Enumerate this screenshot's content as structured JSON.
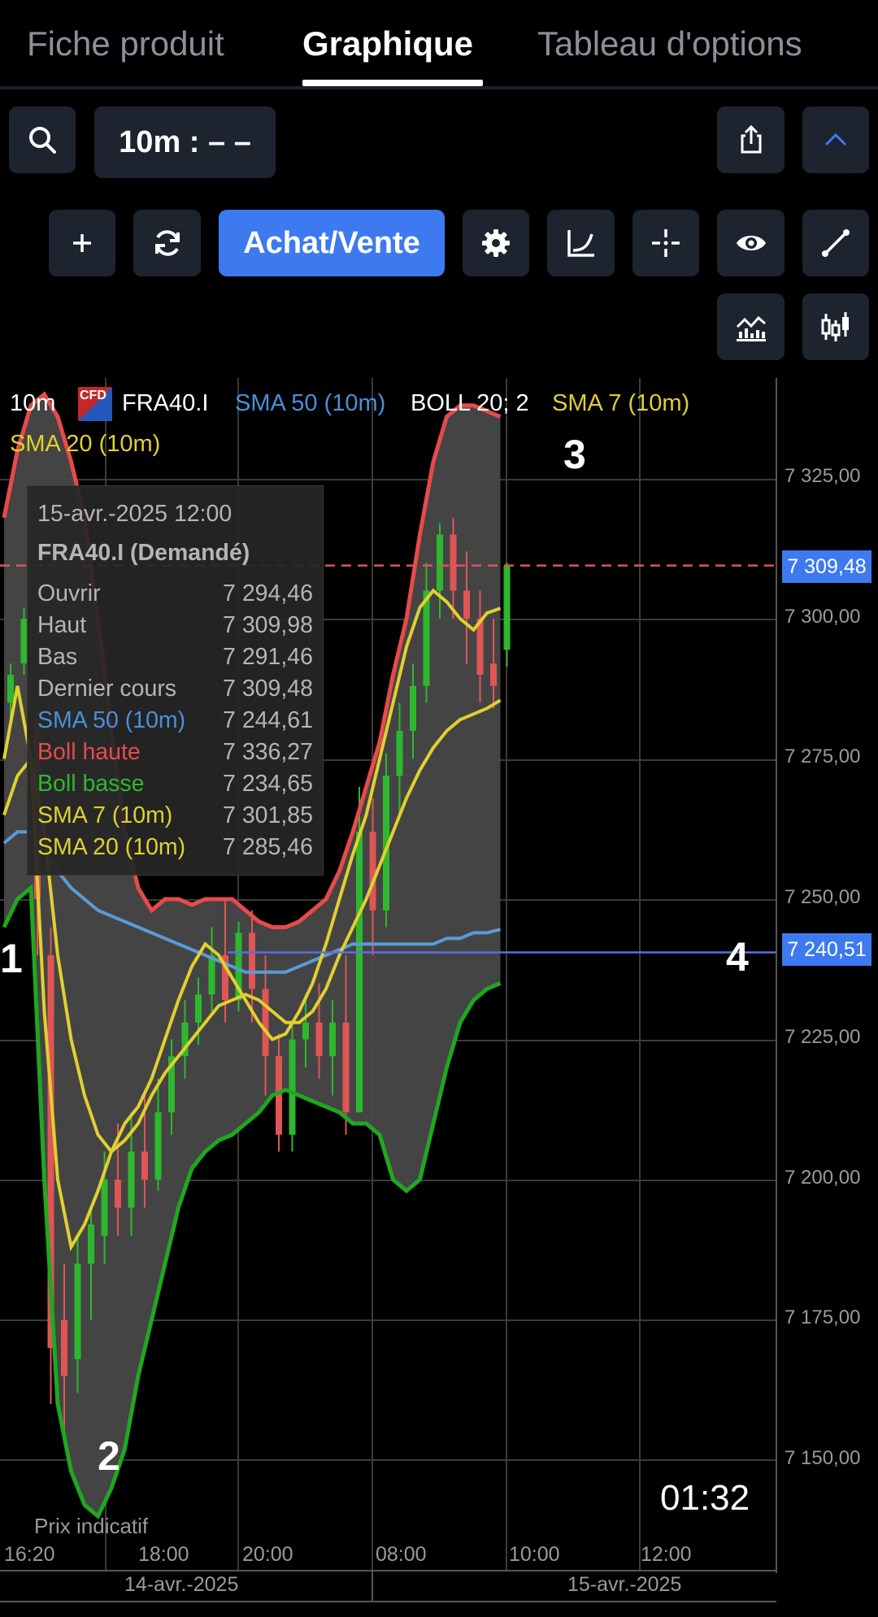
{
  "tabs": [
    {
      "label": "Fiche produit",
      "active": false
    },
    {
      "label": "Graphique",
      "active": true
    },
    {
      "label": "Tableau d'options",
      "active": false
    }
  ],
  "toolbar": {
    "interval_label": "10m : – –",
    "trade_button_label": "Achat/Vente",
    "icons": [
      "search-icon",
      "share-icon",
      "chevron-up-icon",
      "plus-icon",
      "refresh-icon",
      "gear-icon",
      "curve-icon",
      "crosshair-icon",
      "eye-icon",
      "draw-line-icon",
      "indicators-icon",
      "candlestick-icon"
    ]
  },
  "chart_header": {
    "interval": "10m",
    "cfd_badge": "CFD",
    "symbol": "FRA40.I",
    "sma50_label": "SMA 50 (10m)",
    "boll_label": "BOLL 20; 2",
    "sma7_label": "SMA 7 (10m)",
    "sma20_label": "SMA 20 (10m)"
  },
  "tooltip": {
    "datetime": "15-avr.-2025 12:00",
    "instrument": "FRA40.I (Demandé)",
    "rows": [
      {
        "label": "Ouvrir",
        "value": "7 294,46",
        "color": "#b5b5b5"
      },
      {
        "label": "Haut",
        "value": "7 309,98",
        "color": "#b5b5b5"
      },
      {
        "label": "Bas",
        "value": "7 291,46",
        "color": "#b5b5b5"
      },
      {
        "label": "Dernier cours",
        "value": "7 309,48",
        "color": "#b5b5b5"
      },
      {
        "label": "SMA 50 (10m)",
        "value": "7 244,61",
        "color": "#4a90d9"
      },
      {
        "label": "Boll haute",
        "value": "7 336,27",
        "color": "#e84a4a"
      },
      {
        "label": "Boll basse",
        "value": "7 234,65",
        "color": "#2eb82e"
      },
      {
        "label": "SMA 7 (10m)",
        "value": "7 301,85",
        "color": "#e0d030"
      },
      {
        "label": "SMA 20 (10m)",
        "value": "7 285,46",
        "color": "#e0d030"
      }
    ]
  },
  "price_axis": [
    "7 325,00",
    "7 300,00",
    "7 275,00",
    "7 250,00",
    "7 225,00",
    "7 200,00",
    "7 175,00",
    "7 150,00"
  ],
  "last_price_flag": "7 309,48",
  "hline_flag": "7 240,51",
  "time_axis": [
    "16:20",
    "18:00",
    "20:00",
    "08:00",
    "10:00",
    "12:00"
  ],
  "date_axis": [
    "14-avr.-2025",
    "15-avr.-2025"
  ],
  "markers": [
    "1",
    "2",
    "3",
    "4"
  ],
  "indicative_price_label": "Prix indicatif",
  "countdown": "01:32",
  "colors": {
    "bull": "#2eb82e",
    "bear": "#e05555",
    "boll_upper": "#e84a4a",
    "boll_lower": "#1fa81f",
    "sma": "#e0d030",
    "sma50": "#5a9bd8",
    "accent": "#3d7af0"
  },
  "chart_data": {
    "type": "candlestick",
    "symbol": "FRA40.I",
    "interval": "10m",
    "y_range": [
      7135,
      7345
    ],
    "last_price": 7309.48,
    "horizontal_line": 7240.51,
    "candles": [
      {
        "o": 7285,
        "h": 7292,
        "c": 7290,
        "l": 7282
      },
      {
        "o": 7292,
        "h": 7302,
        "c": 7300,
        "l": 7290
      },
      {
        "o": 7282,
        "h": 7285,
        "c": 7250,
        "l": 7240
      },
      {
        "o": 7240,
        "h": 7245,
        "c": 7170,
        "l": 7160
      },
      {
        "o": 7175,
        "h": 7185,
        "c": 7165,
        "l": 7155
      },
      {
        "o": 7168,
        "h": 7190,
        "c": 7185,
        "l": 7162
      },
      {
        "o": 7185,
        "h": 7195,
        "c": 7192,
        "l": 7175
      },
      {
        "o": 7190,
        "h": 7205,
        "c": 7200,
        "l": 7185
      },
      {
        "o": 7200,
        "h": 7210,
        "c": 7195,
        "l": 7190
      },
      {
        "o": 7195,
        "h": 7212,
        "c": 7205,
        "l": 7190
      },
      {
        "o": 7205,
        "h": 7215,
        "c": 7200,
        "l": 7195
      },
      {
        "o": 7200,
        "h": 7218,
        "c": 7212,
        "l": 7198
      },
      {
        "o": 7212,
        "h": 7225,
        "c": 7222,
        "l": 7208
      },
      {
        "o": 7222,
        "h": 7232,
        "c": 7228,
        "l": 7218
      },
      {
        "o": 7228,
        "h": 7236,
        "c": 7233,
        "l": 7224
      },
      {
        "o": 7233,
        "h": 7245,
        "c": 7240,
        "l": 7230
      },
      {
        "o": 7240,
        "h": 7250,
        "c": 7232,
        "l": 7228
      },
      {
        "o": 7232,
        "h": 7246,
        "c": 7244,
        "l": 7230
      },
      {
        "o": 7244,
        "h": 7248,
        "c": 7234,
        "l": 7228
      },
      {
        "o": 7234,
        "h": 7240,
        "c": 7222,
        "l": 7215
      },
      {
        "o": 7222,
        "h": 7226,
        "c": 7208,
        "l": 7205
      },
      {
        "o": 7208,
        "h": 7228,
        "c": 7225,
        "l": 7205
      },
      {
        "o": 7225,
        "h": 7233,
        "c": 7228,
        "l": 7220
      },
      {
        "o": 7228,
        "h": 7235,
        "c": 7222,
        "l": 7218
      },
      {
        "o": 7222,
        "h": 7232,
        "c": 7228,
        "l": 7215
      },
      {
        "o": 7228,
        "h": 7240,
        "c": 7212,
        "l": 7208
      },
      {
        "o": 7212,
        "h": 7270,
        "c": 7262,
        "l": 7212
      },
      {
        "o": 7262,
        "h": 7268,
        "c": 7248,
        "l": 7240
      },
      {
        "o": 7248,
        "h": 7276,
        "c": 7272,
        "l": 7245
      },
      {
        "o": 7272,
        "h": 7285,
        "c": 7280,
        "l": 7265
      },
      {
        "o": 7280,
        "h": 7292,
        "c": 7288,
        "l": 7275
      },
      {
        "o": 7288,
        "h": 7310,
        "c": 7305,
        "l": 7285
      },
      {
        "o": 7305,
        "h": 7317,
        "c": 7315,
        "l": 7300
      },
      {
        "o": 7315,
        "h": 7318,
        "c": 7305,
        "l": 7300
      },
      {
        "o": 7305,
        "h": 7312,
        "c": 7300,
        "l": 7292
      },
      {
        "o": 7300,
        "h": 7305,
        "c": 7290,
        "l": 7285
      },
      {
        "o": 7292,
        "h": 7300,
        "c": 7288,
        "l": 7284
      },
      {
        "o": 7294.46,
        "h": 7309.98,
        "c": 7309.48,
        "l": 7291.46
      }
    ],
    "series": [
      {
        "name": "Boll haute",
        "values": [
          7318,
          7330,
          7338,
          7340,
          7336,
          7328,
          7318,
          7300,
          7280,
          7262,
          7252,
          7248,
          7250,
          7250,
          7249,
          7250,
          7250,
          7250,
          7248,
          7246,
          7245,
          7245,
          7246,
          7248,
          7250,
          7255,
          7262,
          7270,
          7278,
          7290,
          7300,
          7315,
          7328,
          7336,
          7338,
          7338,
          7337,
          7336
        ]
      },
      {
        "name": "Boll basse",
        "values": [
          7245,
          7250,
          7252,
          7200,
          7160,
          7148,
          7142,
          7140,
          7145,
          7152,
          7165,
          7175,
          7185,
          7195,
          7202,
          7205,
          7207,
          7208,
          7210,
          7212,
          7215,
          7216,
          7215,
          7214,
          7213,
          7212,
          7210,
          7210,
          7208,
          7200,
          7198,
          7200,
          7210,
          7220,
          7228,
          7232,
          7234,
          7235
        ]
      },
      {
        "name": "SMA 7 (10m)",
        "values": [
          7275,
          7288,
          7275,
          7230,
          7200,
          7188,
          7192,
          7198,
          7205,
          7210,
          7213,
          7218,
          7225,
          7232,
          7238,
          7242,
          7240,
          7236,
          7232,
          7228,
          7225,
          7226,
          7230,
          7235,
          7242,
          7250,
          7258,
          7265,
          7275,
          7285,
          7295,
          7302,
          7305,
          7303,
          7300,
          7298,
          7301,
          7301.85
        ]
      },
      {
        "name": "SMA 20 (10m)",
        "values": [
          7265,
          7272,
          7275,
          7262,
          7240,
          7225,
          7215,
          7208,
          7205,
          7207,
          7210,
          7215,
          7219,
          7222,
          7225,
          7228,
          7231,
          7232,
          7233,
          7232,
          7230,
          7228,
          7228,
          7230,
          7234,
          7240,
          7245,
          7250,
          7256,
          7262,
          7268,
          7273,
          7277,
          7280,
          7282,
          7283,
          7284,
          7285.46
        ]
      },
      {
        "name": "SMA 50 (10m)",
        "values": [
          7260,
          7262,
          7262,
          7258,
          7255,
          7252,
          7250,
          7248,
          7247,
          7246,
          7245,
          7244,
          7243,
          7242,
          7241,
          7240,
          7239,
          7238,
          7237,
          7237,
          7237,
          7237,
          7238,
          7239,
          7240,
          7241,
          7242,
          7242,
          7242,
          7242,
          7242,
          7242,
          7242,
          7243,
          7243,
          7244,
          7244,
          7244.61
        ]
      }
    ]
  }
}
